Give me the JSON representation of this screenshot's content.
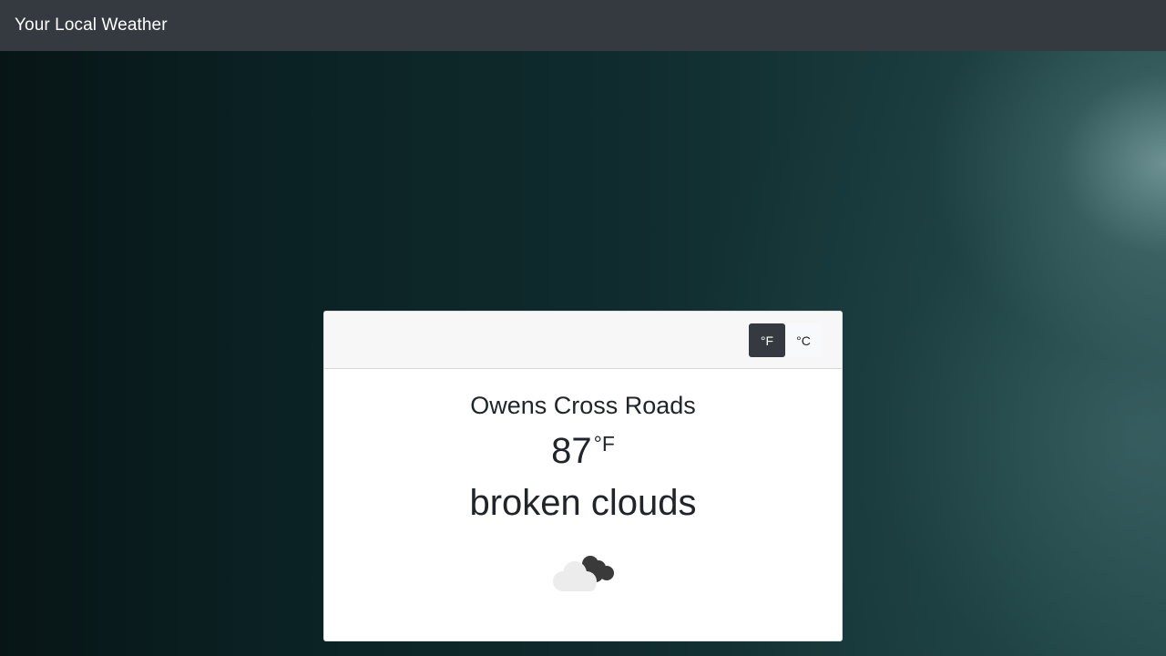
{
  "navbar": {
    "brand": "Your Local Weather"
  },
  "card": {
    "unit_toggle": {
      "fahrenheit_label": "°F",
      "celsius_label": "°C",
      "selected": "°F"
    },
    "location": "Owens Cross Roads",
    "temperature": {
      "value": "87",
      "unit": "°F"
    },
    "condition": "broken clouds",
    "icon": "broken-clouds-icon"
  },
  "colors": {
    "navbar_bg": "#343a40",
    "active_button_bg": "#343a40",
    "card_header_bg": "#f7f7f7",
    "text": "#212529"
  }
}
